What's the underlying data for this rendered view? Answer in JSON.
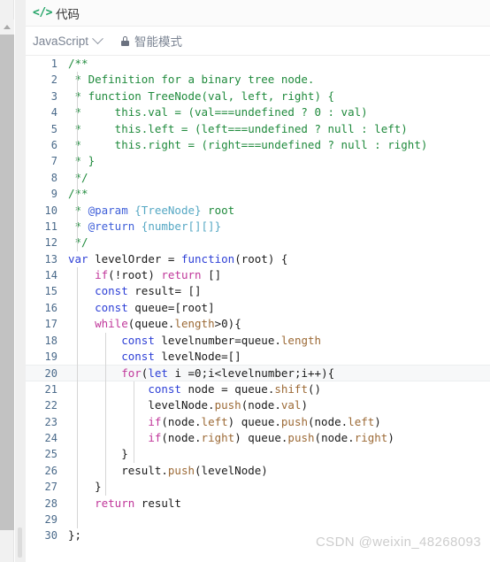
{
  "header": {
    "icon": "code-tag-icon",
    "title": "代码"
  },
  "toolbar": {
    "language": "JavaScript",
    "chevron_icon": "chevron-down-icon",
    "lock_icon": "lock-icon",
    "mode_label": "智能模式"
  },
  "editor": {
    "active_line": 20,
    "total_lines": 30,
    "line_numbers": [
      "1",
      "2",
      "3",
      "4",
      "5",
      "6",
      "7",
      "8",
      "9",
      "10",
      "11",
      "12",
      "13",
      "14",
      "15",
      "16",
      "17",
      "18",
      "19",
      "20",
      "21",
      "22",
      "23",
      "24",
      "25",
      "26",
      "27",
      "28",
      "29",
      "30"
    ],
    "code_lines": [
      "/**",
      " * Definition for a binary tree node.",
      " * function TreeNode(val, left, right) {",
      " *     this.val = (val===undefined ? 0 : val)",
      " *     this.left = (left===undefined ? null : left)",
      " *     this.right = (right===undefined ? null : right)",
      " * }",
      " */",
      "/**",
      " * @param {TreeNode} root",
      " * @return {number[][]}",
      " */",
      "var levelOrder = function(root) {",
      "    if(!root) return []",
      "    const result= []",
      "    const queue=[root]",
      "    while(queue.length>0){",
      "        const levelnumber=queue.length",
      "        const levelNode=[]",
      "        for(let i =0;i<levelnumber;i++){",
      "            const node = queue.shift()",
      "            levelNode.push(node.val)",
      "            if(node.left) queue.push(node.left)",
      "            if(node.right) queue.push(node.right)",
      "        }",
      "        result.push(levelNode)",
      "    }",
      "    return result",
      "",
      "};"
    ]
  },
  "watermark": {
    "text": "CSDN @weixin_48268093"
  },
  "colors": {
    "comment": "#1f8a3c",
    "keyword": "#2d3fd6",
    "control": "#c0379a",
    "method": "#9c6a36",
    "jsdoc_tag": "#3e5fd9",
    "jsdoc_type": "#56a8c4",
    "line_number": "#4a6a8a",
    "accent_green": "#21a366",
    "watermark": "#cdcdcd"
  }
}
